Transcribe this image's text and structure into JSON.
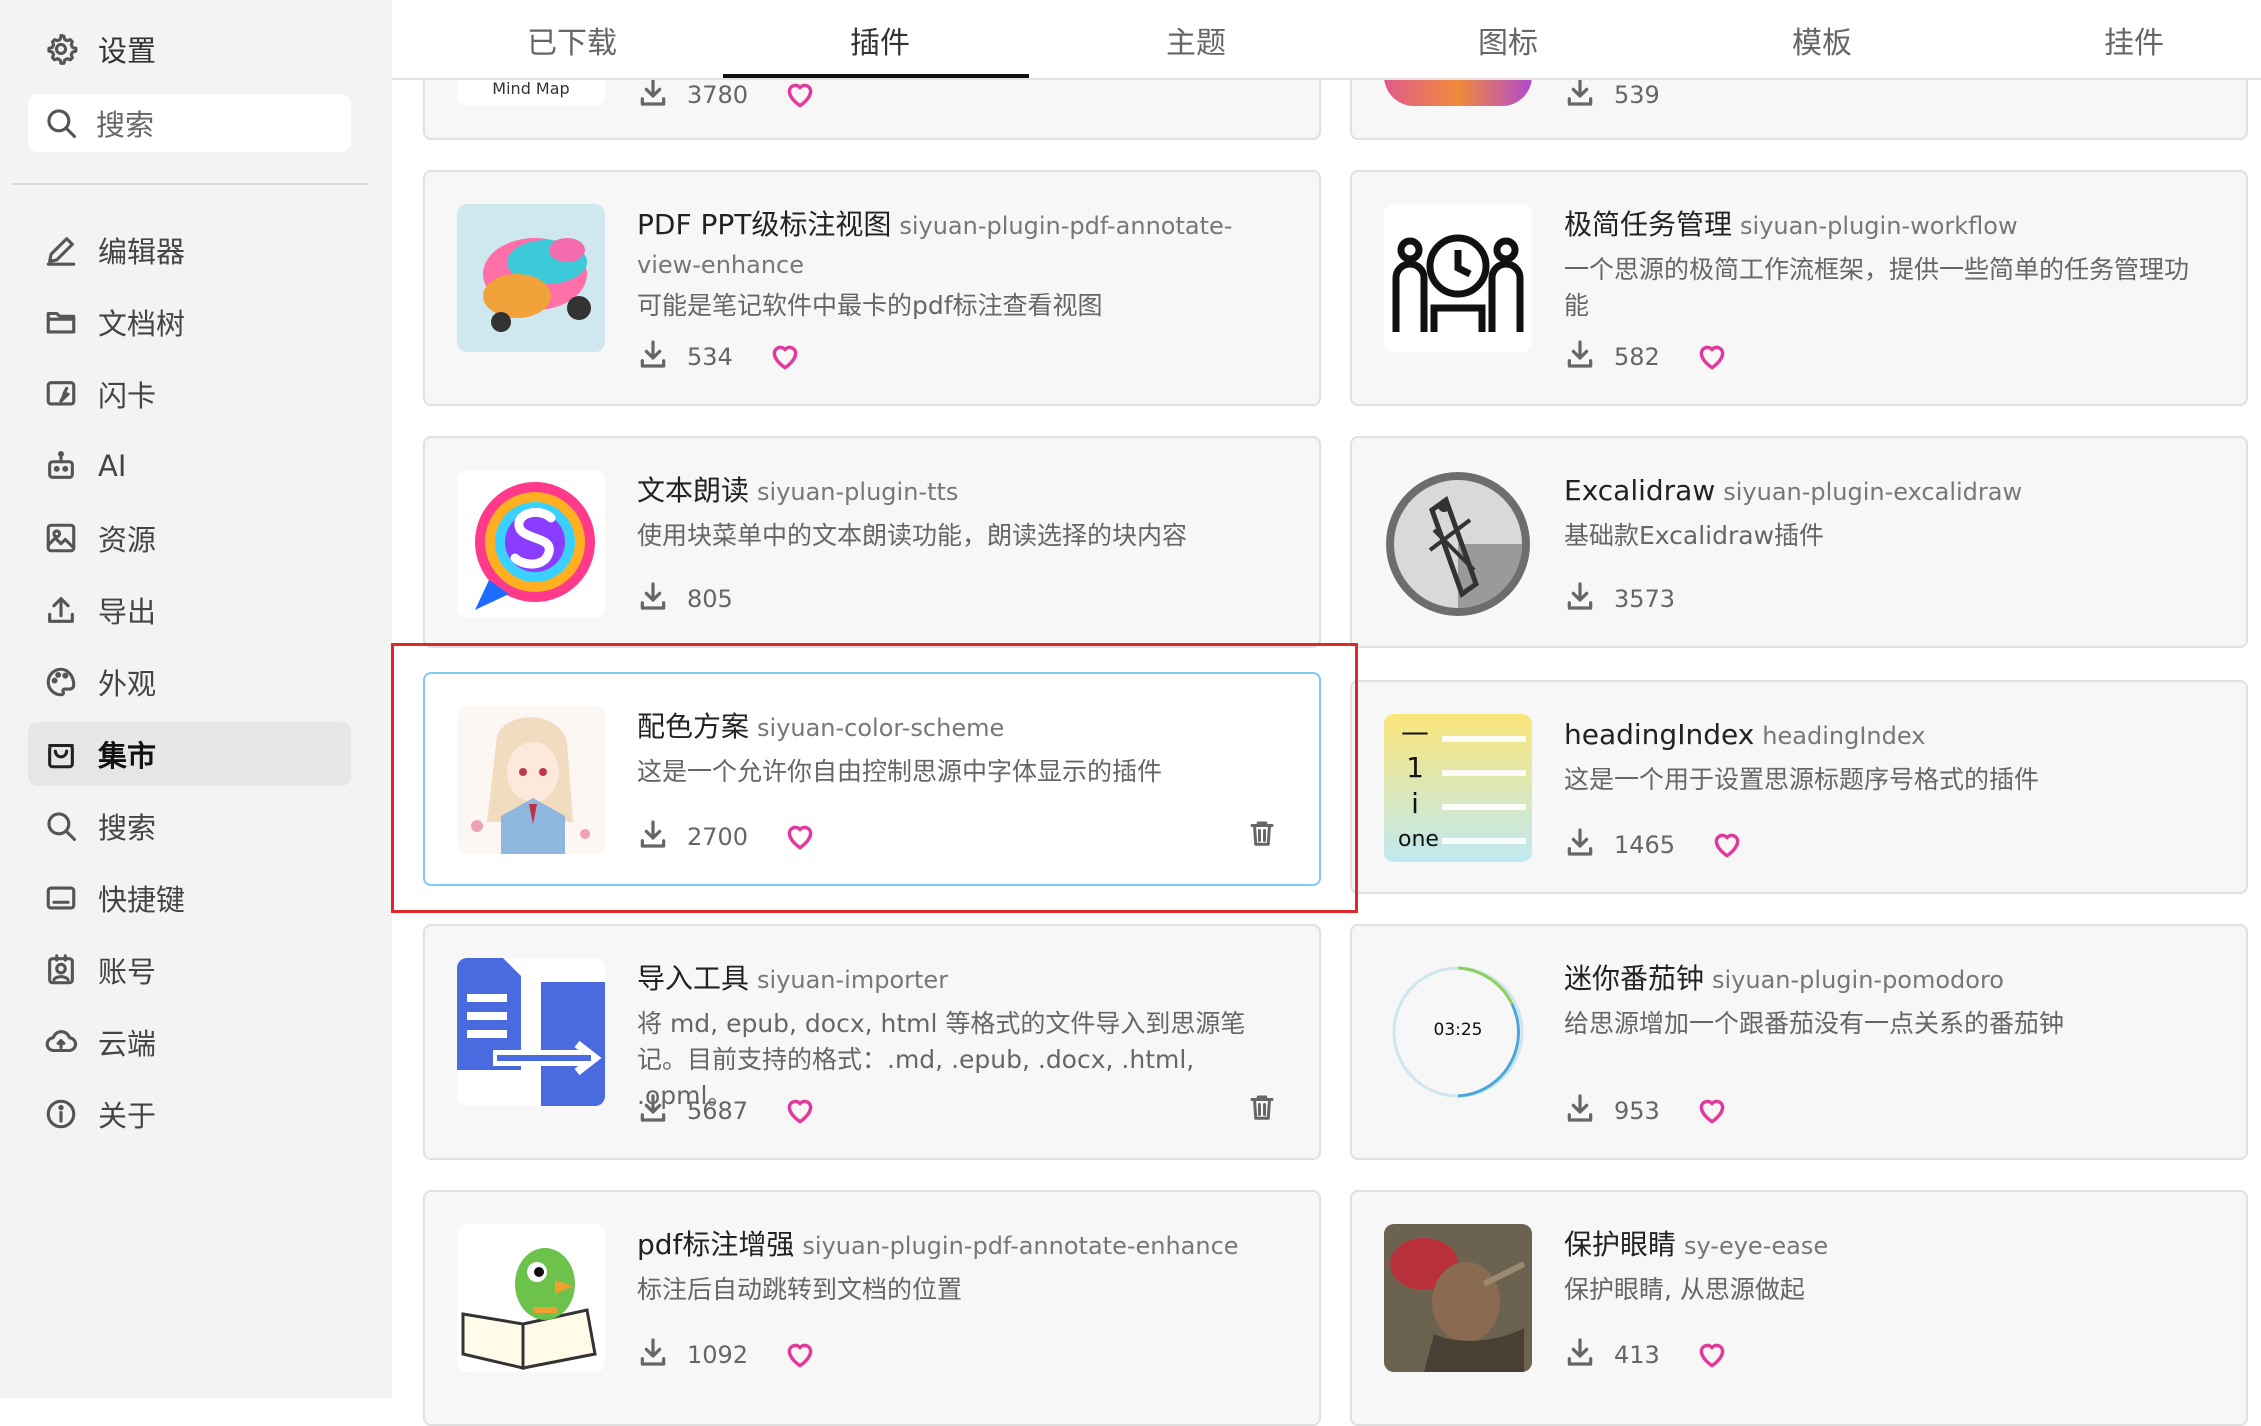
{
  "sidebar": {
    "header": "设置",
    "search_label": "搜索",
    "items": [
      {
        "label": "编辑器",
        "icon": "pencil-icon"
      },
      {
        "label": "文档树",
        "icon": "folder-icon"
      },
      {
        "label": "闪卡",
        "icon": "flashcard-icon"
      },
      {
        "label": "AI",
        "icon": "robot-icon"
      },
      {
        "label": "资源",
        "icon": "image-icon"
      },
      {
        "label": "导出",
        "icon": "upload-icon"
      },
      {
        "label": "外观",
        "icon": "palette-icon"
      },
      {
        "label": "集市",
        "icon": "bag-icon",
        "active": true
      },
      {
        "label": "搜索",
        "icon": "search-icon"
      },
      {
        "label": "快捷键",
        "icon": "keyboard-icon"
      },
      {
        "label": "账号",
        "icon": "account-icon"
      },
      {
        "label": "云端",
        "icon": "cloud-icon"
      },
      {
        "label": "关于",
        "icon": "info-icon"
      }
    ]
  },
  "tabs": [
    {
      "label": "已下载"
    },
    {
      "label": "插件",
      "active": true
    },
    {
      "label": "主题"
    },
    {
      "label": "图标"
    },
    {
      "label": "模板"
    },
    {
      "label": "挂件"
    }
  ],
  "cards": {
    "top_left": {
      "thumb_text": "Mind Map",
      "downloads": "3780"
    },
    "top_right": {
      "downloads": "539"
    },
    "pdf_ppt": {
      "title": "PDF PPT级标注视图",
      "pkg": "siyuan-plugin-pdf-annotate-view-enhance",
      "desc": "可能是笔记软件中最卡的pdf标注查看视图",
      "downloads": "534"
    },
    "workflow": {
      "title": "极简任务管理",
      "pkg": "siyuan-plugin-workflow",
      "desc": "一个思源的极简工作流框架，提供一些简单的任务管理功能",
      "downloads": "582"
    },
    "tts": {
      "title": "文本朗读",
      "pkg": "siyuan-plugin-tts",
      "desc": "使用块菜单中的文本朗读功能，朗读选择的块内容",
      "downloads": "805"
    },
    "excalidraw": {
      "title": "Excalidraw",
      "pkg": "siyuan-plugin-excalidraw",
      "desc": "基础款Excalidraw插件",
      "downloads": "3573"
    },
    "color_scheme": {
      "title": "配色方案",
      "pkg": "siyuan-color-scheme",
      "desc": "这是一个允许你自由控制思源中字体显示的插件",
      "downloads": "2700"
    },
    "heading_index": {
      "title": "headingIndex",
      "pkg": "headingIndex",
      "desc": "这是一个用于设置思源标题序号格式的插件",
      "downloads": "1465",
      "thumb_lines": [
        "—",
        "1",
        "i",
        "one"
      ]
    },
    "importer": {
      "title": "导入工具",
      "pkg": "siyuan-importer",
      "desc": "将 md, epub, docx, html 等格式的文件导入到思源笔记。目前支持的格式：.md, .epub, .docx, .html, .opml。",
      "downloads": "5687"
    },
    "pomodoro": {
      "title": "迷你番茄钟",
      "pkg": "siyuan-plugin-pomodoro",
      "desc": "给思源增加一个跟番茄没有一点关系的番茄钟",
      "downloads": "953",
      "thumb_time": "03:25"
    },
    "pdf_enhance": {
      "title": "pdf标注增强",
      "pkg": "siyuan-plugin-pdf-annotate-enhance",
      "desc": "标注后自动跳转到文档的位置",
      "downloads": "1092"
    },
    "eye_ease": {
      "title": "保护眼睛",
      "pkg": "sy-eye-ease",
      "desc": "保护眼睛, 从思源做起",
      "downloads": "413"
    }
  },
  "colors": {
    "accent_heart": "#e4399c",
    "highlight_border": "#e02828",
    "selected_border": "#7fc9f2"
  }
}
